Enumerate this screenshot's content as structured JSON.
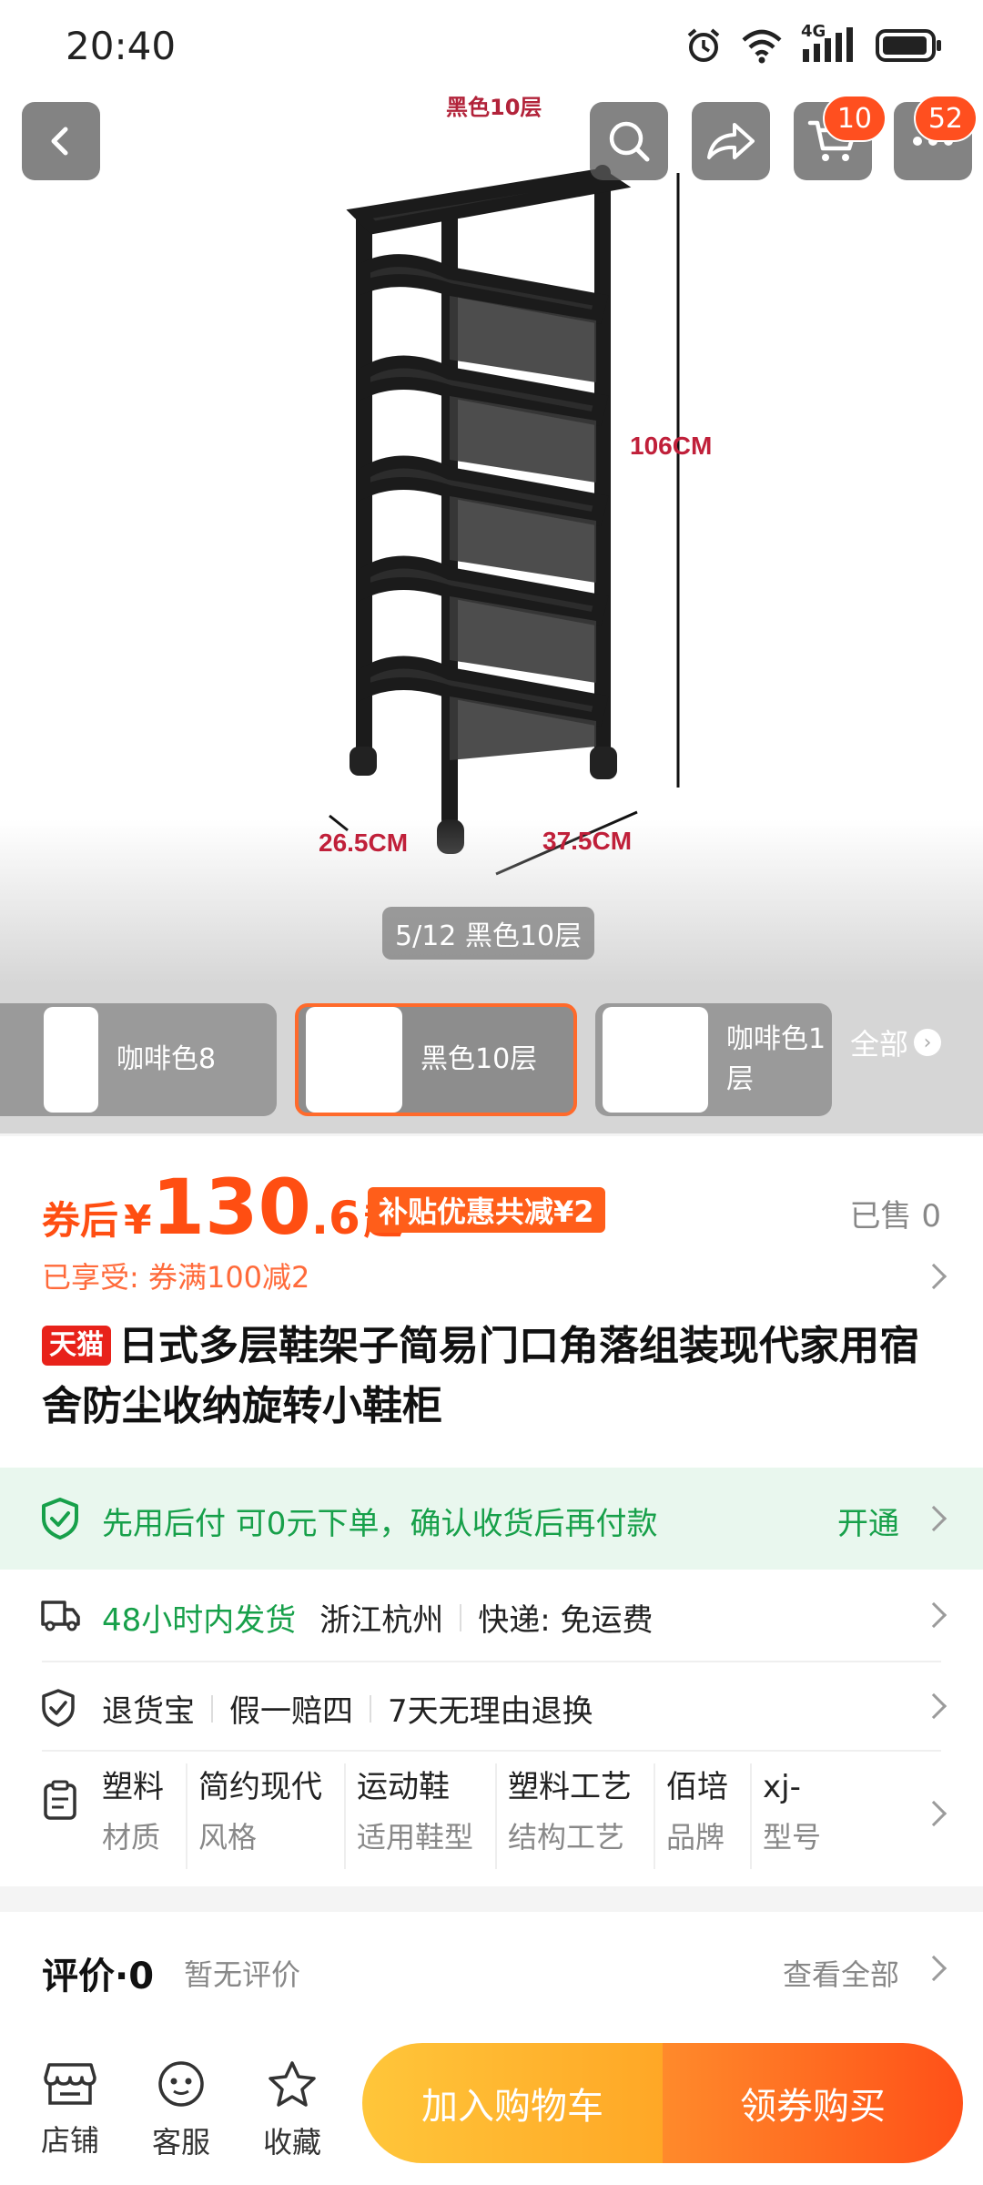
{
  "status_bar": {
    "time": "20:40",
    "network": "4G"
  },
  "top_bar": {
    "cart_count": "10",
    "more_count": "52"
  },
  "hero": {
    "image_caption": "黑色10层",
    "dims": {
      "height": "106CM",
      "depth": "26.5CM",
      "width": "37.5CM"
    },
    "counter": "5/12 黑色10层"
  },
  "sku_strip": {
    "items": [
      {
        "label": "咖啡色8"
      },
      {
        "label": "黑色10层"
      },
      {
        "label": "咖啡色1\n层"
      }
    ],
    "all_label": "全部"
  },
  "price": {
    "prefix": "券后",
    "currency": "¥",
    "integer": "130",
    "decimal": ".6",
    "suffix": "起",
    "subsidy": "补贴优惠共减¥2",
    "sold": "已售 0",
    "enjoyed": "已享受: 券满100减2"
  },
  "product": {
    "store_badge": "天猫",
    "title": "日式多层鞋架子简易门口角落组装现代家用宿舍防尘收纳旋转小鞋柜"
  },
  "services": {
    "pay_after": {
      "text": "先用后付 可0元下单，确认收货后再付款",
      "action": "开通"
    },
    "shipping": {
      "time": "48小时内发货",
      "location": "浙江杭州",
      "express": "快递: 免运费"
    },
    "guarantee": {
      "returns": "退货宝",
      "fake": "假一赔四",
      "seven_day": "7天无理由退换"
    },
    "attributes": [
      {
        "value": "塑料",
        "key": "材质"
      },
      {
        "value": "简约现代",
        "key": "风格"
      },
      {
        "value": "运动鞋",
        "key": "适用鞋型"
      },
      {
        "value": "塑料工艺",
        "key": "结构工艺"
      },
      {
        "value": "佰培",
        "key": "品牌"
      },
      {
        "value": "xj-",
        "key": "型号"
      }
    ]
  },
  "reviews": {
    "title": "评价·0",
    "none": "暂无评价",
    "see_all": "查看全部"
  },
  "bottom_bar": {
    "shop": "店铺",
    "service": "客服",
    "favorite": "收藏",
    "add_cart": "加入购物车",
    "buy": "领券购买"
  },
  "colors": {
    "accent": "#ff4e12",
    "green": "#17a04a",
    "tmall_red": "#e8221a"
  }
}
